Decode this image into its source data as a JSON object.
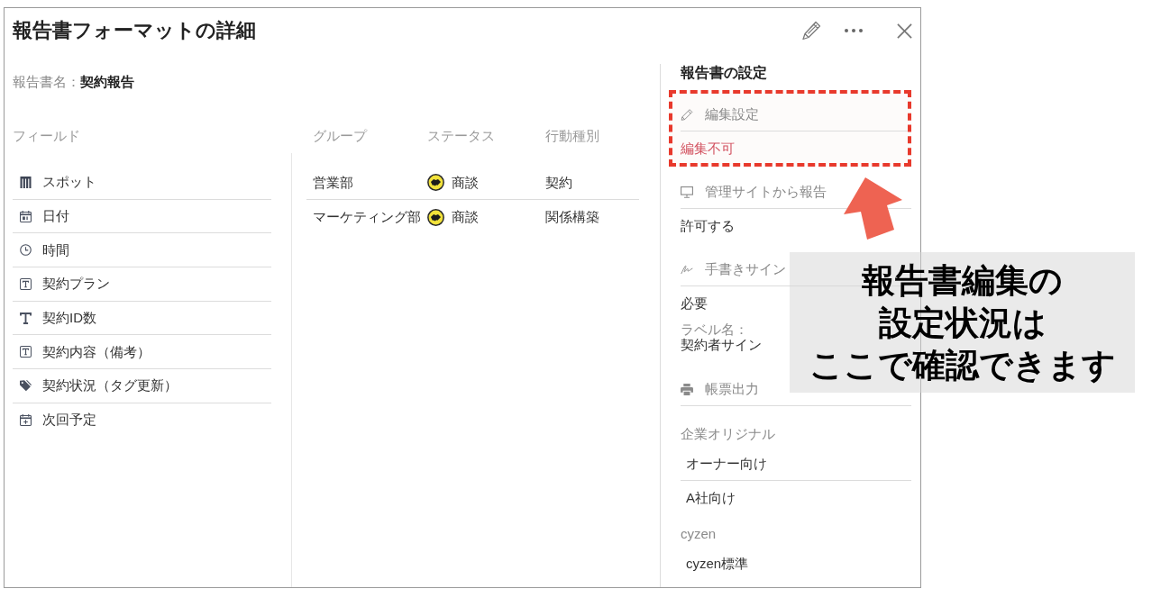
{
  "window": {
    "title": "報告書フォーマットの詳細"
  },
  "report_name": {
    "label": "報告書名：",
    "value": "契約報告"
  },
  "fields": {
    "heading": "フィールド",
    "items": [
      {
        "label": "スポット",
        "kind": "spot"
      },
      {
        "label": "日付",
        "kind": "date"
      },
      {
        "label": "時間",
        "kind": "time"
      },
      {
        "label": "契約プラン",
        "kind": "text_box"
      },
      {
        "label": "契約ID数",
        "kind": "text"
      },
      {
        "label": "契約内容（備考）",
        "kind": "text_box"
      },
      {
        "label": "契約状況（タグ更新）",
        "kind": "tag"
      },
      {
        "label": "次回予定",
        "kind": "schedule"
      }
    ]
  },
  "table": {
    "columns": [
      {
        "label": "グループ",
        "kind": "text"
      },
      {
        "label": "ステータス",
        "kind": "status"
      },
      {
        "label": "行動種別",
        "kind": "text"
      }
    ],
    "rows": [
      {
        "cells": [
          "営業部",
          "商談",
          "契約"
        ]
      },
      {
        "cells": [
          "マーケティング部",
          "商談",
          "関係構築"
        ]
      }
    ]
  },
  "settings": {
    "title": "報告書の設定",
    "sections": [
      {
        "kind": "edit",
        "label": "編集設定",
        "highlighted": true,
        "lines": [
          {
            "kind": "alert",
            "text": "編集不可"
          }
        ]
      },
      {
        "kind": "admin_report",
        "label": "管理サイトから報告",
        "highlighted": false,
        "lines": [
          {
            "kind": "value",
            "text": "許可する"
          }
        ]
      },
      {
        "kind": "signature",
        "label": "手書きサイン",
        "highlighted": false,
        "lines": [
          {
            "kind": "value",
            "text": "必要"
          },
          {
            "kind": "labelled",
            "label": "ラベル名：",
            "text": "契約者サイン"
          }
        ]
      },
      {
        "kind": "print",
        "label": "帳票出力",
        "highlighted": false,
        "lines": [
          {
            "kind": "group",
            "title": "企業オリジナル",
            "options": [
              "オーナー向け",
              "A社向け"
            ]
          },
          {
            "kind": "group",
            "title": "cyzen",
            "options": [
              "cyzen標準"
            ]
          }
        ]
      }
    ]
  },
  "callout": {
    "lines": [
      "報告書編集の",
      "設定状況は",
      "ここで確認できます"
    ]
  }
}
